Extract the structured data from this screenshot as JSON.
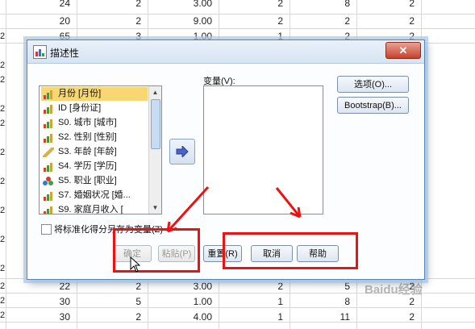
{
  "dialog": {
    "title": "描述性",
    "close_symbol": "✕",
    "variables_label": "变量(V):",
    "variable_list": [
      {
        "label": "月份 [月份]",
        "icon": "bar-chart-icon",
        "selected": true
      },
      {
        "label": "ID [身份证]",
        "icon": "bar-chart-icon",
        "selected": false
      },
      {
        "label": "S0. 城市 [城市]",
        "icon": "bar-chart-icon",
        "selected": false
      },
      {
        "label": "S2. 性别 [性别]",
        "icon": "bar-chart-icon",
        "selected": false
      },
      {
        "label": "S3. 年龄 [年龄]",
        "icon": "ruler-icon",
        "selected": false
      },
      {
        "label": "S4. 学历 [学历]",
        "icon": "bar-chart-icon",
        "selected": false
      },
      {
        "label": "S5. 职业 [职业]",
        "icon": "nominal-balls-icon",
        "selected": false
      },
      {
        "label": "S7. 婚姻状况 [婚...",
        "icon": "bar-chart-icon",
        "selected": false
      },
      {
        "label": "S9. 家庭月收入 [",
        "icon": "bar-chart-icon",
        "selected": false
      }
    ],
    "checkbox_label": "将标准化得分另存为变量(Z)",
    "buttons": {
      "options": "选项(O)...",
      "bootstrap": "Bootstrap(B)...",
      "ok": "确定",
      "paste": "粘贴(P)",
      "reset": "重置(R)",
      "cancel": "取消",
      "help": "帮助"
    }
  },
  "spreadsheet": {
    "rows_top": [
      [
        "24",
        "2",
        "3.00",
        "2",
        "8",
        "2"
      ],
      [
        "20",
        "2",
        "9.00",
        "2",
        "2",
        "2"
      ],
      [
        "65",
        "3",
        "1.00",
        "1",
        "2",
        "2"
      ]
    ],
    "rows_bottom": [
      [
        "22",
        "2",
        "3.00",
        "2",
        "5",
        "2"
      ],
      [
        "30",
        "5",
        "1.00",
        "1",
        "8",
        "2"
      ],
      [
        "30",
        "2",
        "4.00",
        "1",
        "11",
        "2"
      ]
    ],
    "left_numbers": [
      "2",
      "2",
      "2",
      "2",
      "2",
      "2",
      "2",
      "2",
      "2",
      "2",
      "2",
      "2",
      "2",
      "2",
      "2"
    ]
  },
  "watermark": "Baidu经验"
}
